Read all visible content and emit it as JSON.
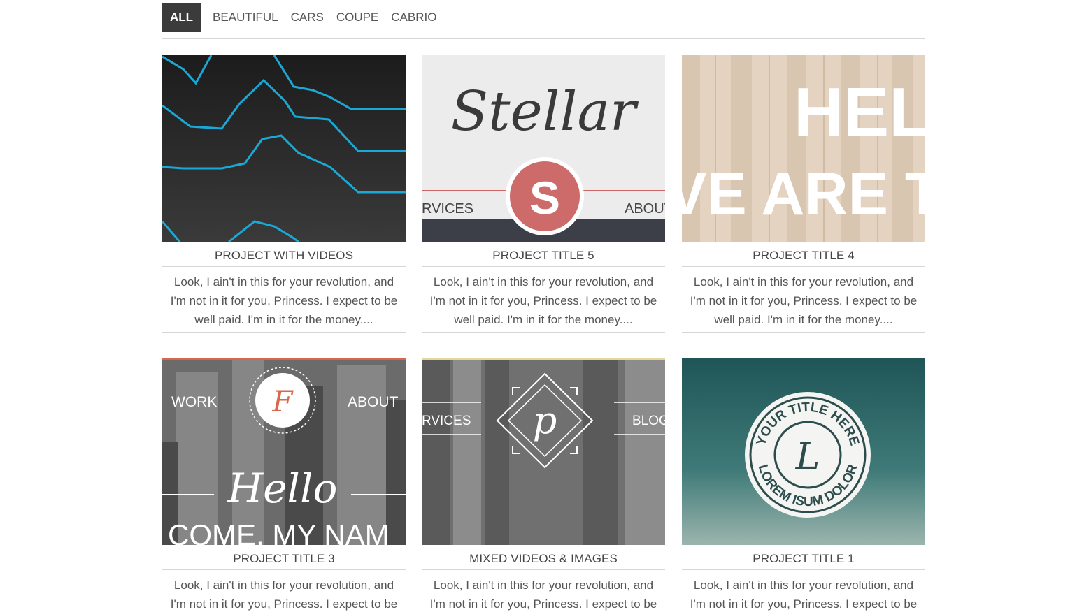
{
  "filters": [
    {
      "label": "ALL",
      "active": true
    },
    {
      "label": "BEAUTIFUL",
      "active": false
    },
    {
      "label": "CARS",
      "active": false
    },
    {
      "label": "COUPE",
      "active": false
    },
    {
      "label": "CABRIO",
      "active": false
    }
  ],
  "projects": [
    {
      "title": "PROJECT WITH VIDEOS",
      "description": "Look, I ain't in this for your revolution, and I'm not in it for you, Princess. I expect to be well paid. I'm in it for the money....",
      "thumb_text": []
    },
    {
      "title": "PROJECT TITLE 5",
      "description": "Look, I ain't in this for your revolution, and I'm not in it for you, Princess. I expect to be well paid. I'm in it for the money....",
      "thumb_text": [
        "Stellar",
        "S",
        "RVICES",
        "ABOUT"
      ]
    },
    {
      "title": "PROJECT TITLE 4",
      "description": "Look, I ain't in this for your revolution, and I'm not in it for you, Princess. I expect to be well paid. I'm in it for the money....",
      "thumb_text": [
        "HEL",
        "VE ARE T"
      ]
    },
    {
      "title": "PROJECT TITLE 3",
      "description": "Look, I ain't in this for your revolution, and I'm not in it for you, Princess. I expect to be",
      "thumb_text": [
        "WORK",
        "F",
        "ABOUT",
        "Hello",
        "COME, MY NAM"
      ]
    },
    {
      "title": "MIXED VIDEOS & IMAGES",
      "description": "Look, I ain't in this for your revolution, and I'm not in it for you, Princess. I expect to be",
      "thumb_text": [
        "RVICES",
        "p",
        "BLOG"
      ]
    },
    {
      "title": "PROJECT TITLE 1",
      "description": "Look, I ain't in this for your revolution, and I'm not in it for you, Princess. I expect to be",
      "thumb_text": [
        "YOUR TITLE HERE",
        "L",
        "LOREM ISUM DOLOR"
      ]
    }
  ],
  "colors": {
    "active_filter_bg": "#3b3b3b",
    "accent_cyan": "#1aa9d6",
    "accent_red": "#cc6666",
    "divider": "#d6d6d6"
  }
}
